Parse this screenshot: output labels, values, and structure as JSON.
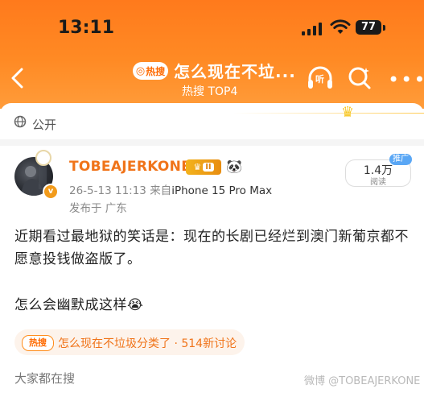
{
  "status_bar": {
    "time": "13:11",
    "battery": "77",
    "icons": [
      "signal-icon",
      "wifi-icon",
      "battery-icon"
    ]
  },
  "header": {
    "back_icon": "chevron-left-icon",
    "hot_badge": "热搜",
    "title": "怎么现在不垃...",
    "subtitle": "热搜 TOP4",
    "listen_label": "听",
    "icons": [
      "headphones-icon",
      "search-icon",
      "more-icon"
    ],
    "bg_color": "#ff7a1c"
  },
  "visibility": {
    "icon": "globe-icon",
    "label": "公开"
  },
  "post": {
    "username": "TOBEAJERKONE",
    "level_badge": "II",
    "emoji": "🐼",
    "time": "26-5-13 11:13",
    "from_prefix": "来自",
    "device": "iPhone 15 Pro Max",
    "location": "发布于 广东",
    "reads_value": "1.4万",
    "reads_label": "阅读",
    "promo_label": "推广",
    "text": "近期看过最地狱的笑话是：现在的长剧已经烂到澳门新葡京都不愿意投钱做盗版了。",
    "text2": "怎么会幽默成这样",
    "text2_emoji": "😭",
    "username_color": "#f0741a"
  },
  "topic": {
    "badge": "热搜",
    "text": "怎么现在不垃圾分类了 · 514新讨论"
  },
  "footer": {
    "section_label": "大家都在搜",
    "watermark": "微博 @TOBEAJERKONE"
  }
}
